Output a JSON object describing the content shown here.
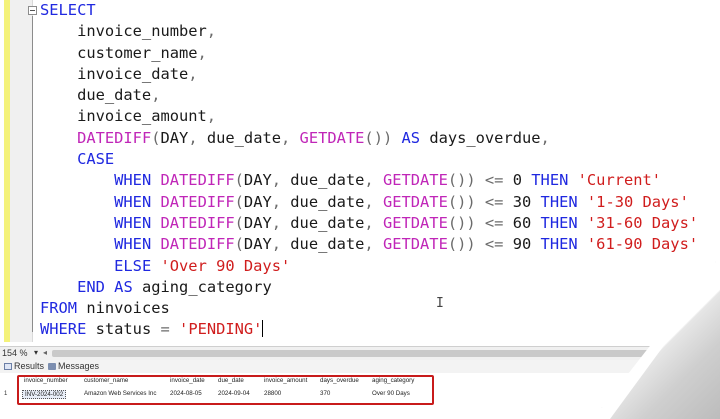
{
  "editor": {
    "lines": [
      [
        {
          "t": "SELECT",
          "c": "kw"
        }
      ],
      [
        {
          "t": "    invoice_number",
          "c": ""
        },
        {
          "t": ",",
          "c": "op"
        }
      ],
      [
        {
          "t": "    customer_name",
          "c": ""
        },
        {
          "t": ",",
          "c": "op"
        }
      ],
      [
        {
          "t": "    invoice_date",
          "c": ""
        },
        {
          "t": ",",
          "c": "op"
        }
      ],
      [
        {
          "t": "    due_date",
          "c": ""
        },
        {
          "t": ",",
          "c": "op"
        }
      ],
      [
        {
          "t": "    invoice_amount",
          "c": ""
        },
        {
          "t": ",",
          "c": "op"
        }
      ],
      [
        {
          "t": "    ",
          "c": ""
        },
        {
          "t": "DATEDIFF",
          "c": "fn"
        },
        {
          "t": "(",
          "c": "op"
        },
        {
          "t": "DAY",
          "c": ""
        },
        {
          "t": ", ",
          "c": "op"
        },
        {
          "t": "due_date",
          "c": ""
        },
        {
          "t": ", ",
          "c": "op"
        },
        {
          "t": "GETDATE",
          "c": "fn"
        },
        {
          "t": "()) ",
          "c": "op"
        },
        {
          "t": "AS",
          "c": "kw"
        },
        {
          "t": " days_overdue",
          "c": ""
        },
        {
          "t": ",",
          "c": "op"
        }
      ],
      [
        {
          "t": "    ",
          "c": ""
        },
        {
          "t": "CASE",
          "c": "kw"
        }
      ],
      [
        {
          "t": "        ",
          "c": ""
        },
        {
          "t": "WHEN",
          "c": "kw"
        },
        {
          "t": " ",
          "c": ""
        },
        {
          "t": "DATEDIFF",
          "c": "fn"
        },
        {
          "t": "(",
          "c": "op"
        },
        {
          "t": "DAY",
          "c": ""
        },
        {
          "t": ", ",
          "c": "op"
        },
        {
          "t": "due_date",
          "c": ""
        },
        {
          "t": ", ",
          "c": "op"
        },
        {
          "t": "GETDATE",
          "c": "fn"
        },
        {
          "t": "()) <= ",
          "c": "op"
        },
        {
          "t": "0",
          "c": ""
        },
        {
          "t": " ",
          "c": ""
        },
        {
          "t": "THEN",
          "c": "kw"
        },
        {
          "t": " ",
          "c": ""
        },
        {
          "t": "'Current'",
          "c": "str"
        }
      ],
      [
        {
          "t": "        ",
          "c": ""
        },
        {
          "t": "WHEN",
          "c": "kw"
        },
        {
          "t": " ",
          "c": ""
        },
        {
          "t": "DATEDIFF",
          "c": "fn"
        },
        {
          "t": "(",
          "c": "op"
        },
        {
          "t": "DAY",
          "c": ""
        },
        {
          "t": ", ",
          "c": "op"
        },
        {
          "t": "due_date",
          "c": ""
        },
        {
          "t": ", ",
          "c": "op"
        },
        {
          "t": "GETDATE",
          "c": "fn"
        },
        {
          "t": "()) <= ",
          "c": "op"
        },
        {
          "t": "30",
          "c": ""
        },
        {
          "t": " ",
          "c": ""
        },
        {
          "t": "THEN",
          "c": "kw"
        },
        {
          "t": " ",
          "c": ""
        },
        {
          "t": "'1-30 Days'",
          "c": "str"
        }
      ],
      [
        {
          "t": "        ",
          "c": ""
        },
        {
          "t": "WHEN",
          "c": "kw"
        },
        {
          "t": " ",
          "c": ""
        },
        {
          "t": "DATEDIFF",
          "c": "fn"
        },
        {
          "t": "(",
          "c": "op"
        },
        {
          "t": "DAY",
          "c": ""
        },
        {
          "t": ", ",
          "c": "op"
        },
        {
          "t": "due_date",
          "c": ""
        },
        {
          "t": ", ",
          "c": "op"
        },
        {
          "t": "GETDATE",
          "c": "fn"
        },
        {
          "t": "()) <= ",
          "c": "op"
        },
        {
          "t": "60",
          "c": ""
        },
        {
          "t": " ",
          "c": ""
        },
        {
          "t": "THEN",
          "c": "kw"
        },
        {
          "t": " ",
          "c": ""
        },
        {
          "t": "'31-60 Days'",
          "c": "str"
        }
      ],
      [
        {
          "t": "        ",
          "c": ""
        },
        {
          "t": "WHEN",
          "c": "kw"
        },
        {
          "t": " ",
          "c": ""
        },
        {
          "t": "DATEDIFF",
          "c": "fn"
        },
        {
          "t": "(",
          "c": "op"
        },
        {
          "t": "DAY",
          "c": ""
        },
        {
          "t": ", ",
          "c": "op"
        },
        {
          "t": "due_date",
          "c": ""
        },
        {
          "t": ", ",
          "c": "op"
        },
        {
          "t": "GETDATE",
          "c": "fn"
        },
        {
          "t": "()) <= ",
          "c": "op"
        },
        {
          "t": "90",
          "c": ""
        },
        {
          "t": " ",
          "c": ""
        },
        {
          "t": "THEN",
          "c": "kw"
        },
        {
          "t": " ",
          "c": ""
        },
        {
          "t": "'61-90 Days'",
          "c": "str"
        }
      ],
      [
        {
          "t": "        ",
          "c": ""
        },
        {
          "t": "ELSE",
          "c": "kw"
        },
        {
          "t": " ",
          "c": ""
        },
        {
          "t": "'Over 90 Days'",
          "c": "str"
        }
      ],
      [
        {
          "t": "    ",
          "c": ""
        },
        {
          "t": "END",
          "c": "kw"
        },
        {
          "t": " ",
          "c": ""
        },
        {
          "t": "AS",
          "c": "kw"
        },
        {
          "t": " aging_category",
          "c": ""
        }
      ],
      [
        {
          "t": "FROM",
          "c": "kw"
        },
        {
          "t": " ninvoices",
          "c": ""
        }
      ],
      [
        {
          "t": "WHERE",
          "c": "kw"
        },
        {
          "t": " status ",
          "c": ""
        },
        {
          "t": "=",
          "c": "op"
        },
        {
          "t": " ",
          "c": ""
        },
        {
          "t": "'PENDING'",
          "c": "str"
        }
      ]
    ]
  },
  "statusbar": {
    "zoom": "154 %",
    "zoom_arrow": "▾",
    "scroll_left": "◂"
  },
  "tabs": {
    "results": "Results",
    "messages": "Messages"
  },
  "results": {
    "columns": [
      "invoice_number",
      "customer_name",
      "invoice_date",
      "due_date",
      "invoice_amount",
      "days_overdue",
      "aging_category"
    ],
    "rows": [
      {
        "num": "1",
        "cells": [
          "INV-2024-002",
          "Amazon Web Services Inc",
          "2024-08-05",
          "2024-09-04",
          "28800",
          "370",
          "Over 90 Days"
        ]
      }
    ]
  }
}
